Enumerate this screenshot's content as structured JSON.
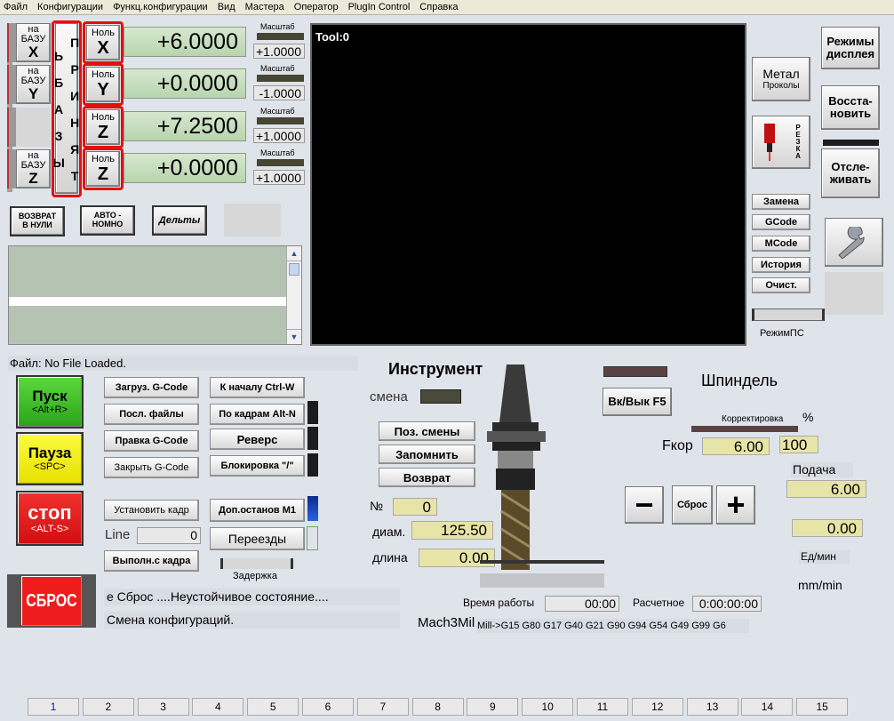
{
  "menu": [
    "Файл",
    "Конфигурации",
    "Функц.конфигурации",
    "Вид",
    "Мастера",
    "Оператор",
    "PlugIn Control",
    "Справка"
  ],
  "axes": [
    {
      "ref_label": "на\nБАЗУ",
      "axis": "X",
      "zero_label": "Ноль",
      "zero_axis": "X",
      "value": "+6.0000",
      "scale_label": "Масштаб",
      "scale": "+1.0000"
    },
    {
      "ref_label": "на\nБАЗУ",
      "axis": "Y",
      "zero_label": "Ноль",
      "zero_axis": "Y",
      "value": "+0.0000",
      "scale_label": "Масштаб",
      "scale": "-1.0000"
    },
    {
      "ref_label": "",
      "axis": "",
      "zero_label": "Ноль",
      "zero_axis": "Z",
      "value": "+7.2500",
      "scale_label": "Масштаб",
      "scale": "+1.0000"
    },
    {
      "ref_label": "на\nБАЗУ",
      "axis": "Z",
      "zero_label": "Ноль",
      "zero_axis": "Z",
      "value": "+0.0000",
      "scale_label": "Масштаб",
      "scale": "+1.0000"
    }
  ],
  "accept_bases": "П Р И Н Я Т Ь     Б А З Ы",
  "return_zero": "ВОЗВРАТ\nВ НУЛИ",
  "auto": "АВТО -\nНОМНО",
  "deltas": "Дельты",
  "tool_label": "Tool:0",
  "right_buttons": {
    "metal": "Метал",
    "proc": "Проколы",
    "cut": "Р\nЕ\nЗ\nК\nА",
    "display_modes": "Режимы\nдисплея",
    "restore": "Восста-\nновить",
    "track": "Отсле-\nживать",
    "replace": "Замена",
    "gcode": "GCode",
    "mcode": "MCode",
    "history": "История",
    "clear": "Очист.",
    "mode_ps": "РежимПС"
  },
  "file": {
    "label": "Файл:",
    "value": "No File Loaded."
  },
  "run": {
    "start": "Пуск",
    "start_key": "<Alt+R>",
    "pause": "Пауза",
    "pause_key": "<SPC>",
    "stop": "стоп",
    "stop_key": "<ALT-S>",
    "reset": "СБРОС"
  },
  "gcode_buttons": {
    "load": "Загруз. G-Code",
    "recent": "Посл. файлы",
    "edit": "Правка G-Code",
    "close": "Закрыть G-Code",
    "rewind": "К началу Ctrl-W",
    "single": "По кадрам Alt-N",
    "reverse": "Реверс",
    "block_delete": "Блокировка \"/\"",
    "set_line": "Установить кадр",
    "line_label": "Line",
    "line_value": "0",
    "run_from": "Выполн.с кадра",
    "opt_stop": "Доп.останов M1",
    "moves": "Переезды",
    "delay": "Задержка"
  },
  "tool": {
    "title": "Инструмент",
    "change": "смена",
    "pos_change": "Поз. смены",
    "remember": "Запомнить",
    "return": "Возврат",
    "num_label": "№",
    "num": "0",
    "diam_label": "диам.",
    "diam": "125.50",
    "len_label": "длина",
    "len": "0.00"
  },
  "spindle": {
    "title": "Шпиндель",
    "onoff": "Вк/Вык F5",
    "override_label": "Корректировка",
    "pct": "%",
    "fkor_label": "Fкор",
    "fkor": "6.00",
    "pct_value": "100",
    "minus": "−",
    "reset": "Сброс",
    "plus": "+",
    "feed_label": "Подача",
    "feed": "6.00",
    "feed2": "0.00",
    "units1": "Ед/мин",
    "units2": "mm/min"
  },
  "status": {
    "msg1": "е Сброс ....Неустойчивое состояние....",
    "msg2": "Смена конфигураций.",
    "runtime_label": "Время работы",
    "runtime": "00:00",
    "est_label": "Расчетное",
    "est": "0:00:00:00",
    "mach": "Mach3Mil",
    "modal": "Mill->G15  G80 G17 G40 G21 G90 G94 G54 G49 G99 G6"
  },
  "tabs": [
    "1",
    "2",
    "3",
    "4",
    "5",
    "6",
    "7",
    "8",
    "9",
    "10",
    "11",
    "12",
    "13",
    "14",
    "15"
  ]
}
